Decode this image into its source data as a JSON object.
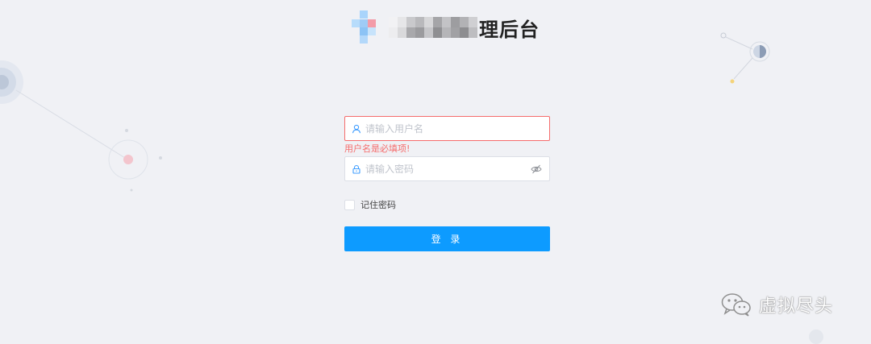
{
  "header": {
    "title_suffix": "理后台"
  },
  "form": {
    "username": {
      "placeholder": "请输入用户名",
      "value": "",
      "error": "用户名是必填项!",
      "icon": "user-icon"
    },
    "password": {
      "placeholder": "请输入密码",
      "value": "",
      "icon": "lock-icon",
      "toggle_icon": "eye-off-icon"
    },
    "remember_label": "记住密码",
    "remember_checked": false,
    "submit_label": "登 录"
  },
  "watermark": {
    "text": "虚拟尽头",
    "icon": "wechat-icon"
  },
  "colors": {
    "background": "#f0f1f5",
    "primary": "#0d9bff",
    "error": "#f56c6c",
    "input_icon": "#409eff"
  }
}
